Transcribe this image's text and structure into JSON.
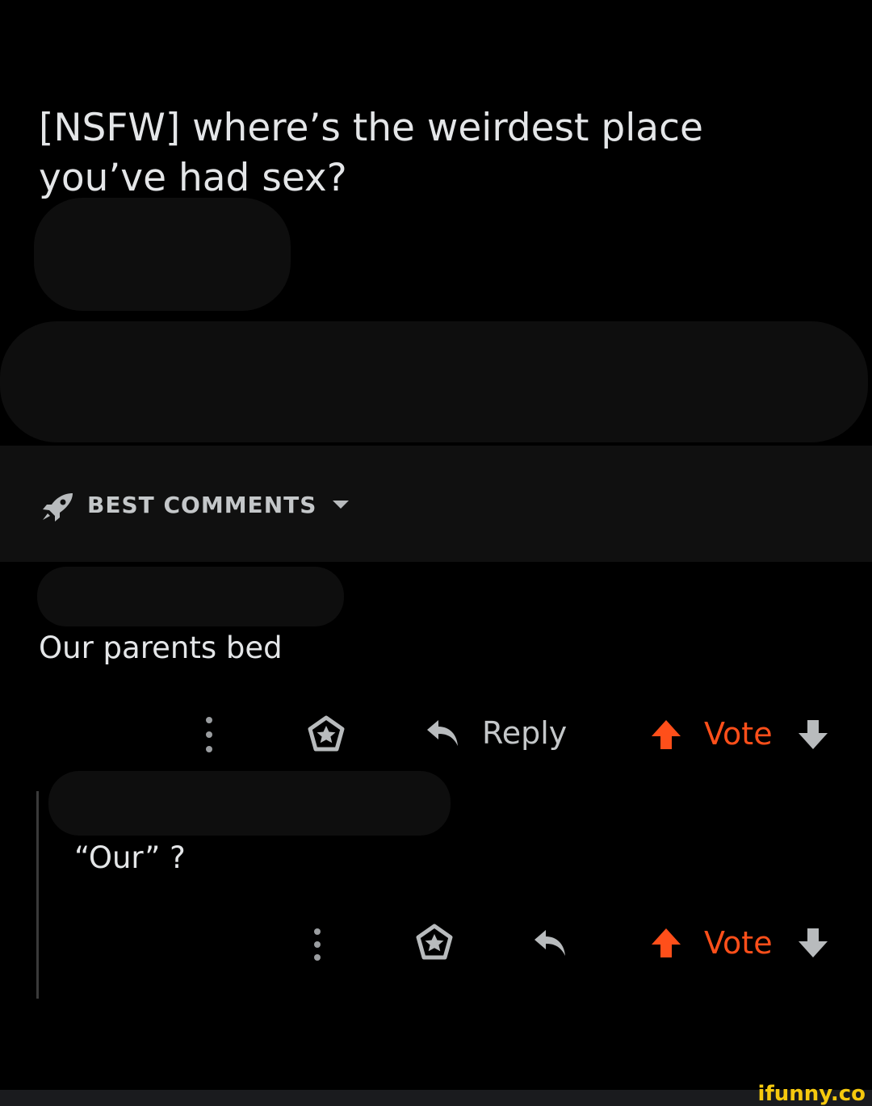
{
  "post": {
    "title": "[NSFW] where’s the weirdest place you’ve had sex?"
  },
  "sort_bar": {
    "label": "BEST COMMENTS",
    "icon": "rocket-icon"
  },
  "comments": [
    {
      "text": "Our parents bed",
      "actions": {
        "more_icon": "more-options-icon",
        "award_icon": "award-icon",
        "reply_icon": "reply-arrow-icon",
        "reply_label": "Reply",
        "vote_label": "Vote",
        "upvote_icon": "upvote-arrow-icon",
        "downvote_icon": "downvote-arrow-icon"
      }
    },
    {
      "text": "“Our” ?",
      "actions": {
        "more_icon": "more-options-icon",
        "award_icon": "award-icon",
        "reply_icon": "reply-arrow-icon",
        "vote_label": "Vote",
        "upvote_icon": "upvote-arrow-icon",
        "downvote_icon": "downvote-arrow-icon"
      }
    }
  ],
  "colors": {
    "background": "#000000",
    "vote_orange": "#ff4f1a",
    "text": "#e4e6e8",
    "muted": "#c4c7c9"
  },
  "watermark": "ifunny.co"
}
